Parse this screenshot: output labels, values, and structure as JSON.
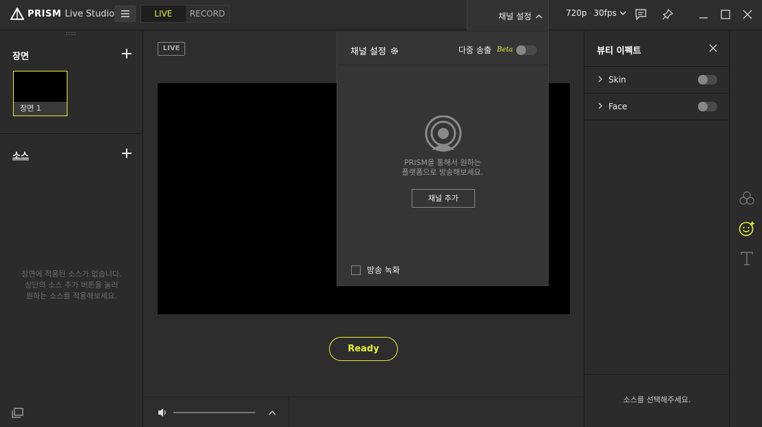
{
  "app": {
    "title_bold": "PRISM",
    "title_rest": "Live Studio"
  },
  "topbar": {
    "modes": [
      "LIVE",
      "RECORD"
    ],
    "active_mode": "LIVE",
    "channel_settings": "채널 설정",
    "resolution": "720p",
    "fps": "30fps",
    "icons": [
      "menu-icon",
      "chevron-up-icon",
      "chevron-down-icon",
      "chat-icon",
      "pin-icon",
      "minimize-icon",
      "maximize-icon",
      "close-icon"
    ]
  },
  "left": {
    "scenes_title": "장면",
    "scene_items": [
      {
        "label": "장면 1",
        "selected": true
      }
    ],
    "sources_title": "소스",
    "empty_sources": [
      "장면에 적용된 소스가 없습니다.",
      "상단의 소스 추가 버튼을 눌러",
      "원하는 소스를 적용해보세요."
    ]
  },
  "center": {
    "live_tag": "LIVE",
    "ready_button": "Ready",
    "volume_level": 1.0
  },
  "dropdown": {
    "title": "채널 설정",
    "multi_stream": "다중 송출",
    "beta": "Beta",
    "message_line1": "PRISM을 통해서 원하는",
    "message_line2": "플랫폼으로 방송해보세요.",
    "add_channel": "채널 추가",
    "record_broadcast": "방송 녹화"
  },
  "right": {
    "title": "뷰티 이펙트",
    "effects": [
      {
        "label": "Skin",
        "enabled": false
      },
      {
        "label": "Face",
        "enabled": false
      }
    ],
    "select_source_msg": "소스를 선택해주세요."
  },
  "colors": {
    "accent": "#e8f03a",
    "background": "#2b2b2b",
    "preview": "#000000"
  }
}
